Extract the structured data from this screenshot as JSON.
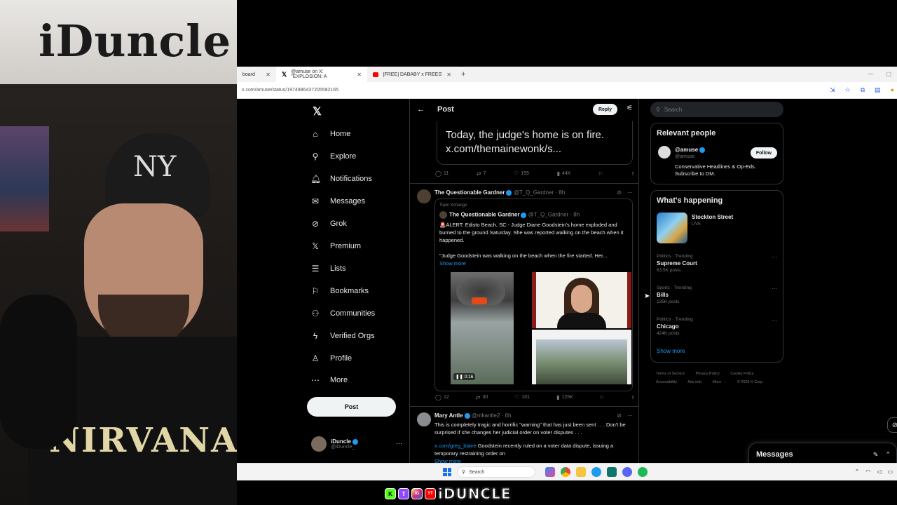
{
  "webcam": {
    "wall_logo": "iDuncle",
    "cap_logo": "NY",
    "shirt_text": "NIRVANA"
  },
  "browser": {
    "tabs": [
      {
        "label": "board",
        "active": false
      },
      {
        "label": "@amuse on X: \"EXPLOSION: A",
        "active": true
      },
      {
        "label": "[FREE] DABABY x FREESTYLE T",
        "active": false
      }
    ],
    "new_tab": "+",
    "url": "x.com/amuse/status/1974986437205582165"
  },
  "nav": {
    "items": [
      {
        "label": "Home",
        "icon": "home-icon",
        "glyph": "⌂"
      },
      {
        "label": "Explore",
        "icon": "search-icon",
        "glyph": "⚲"
      },
      {
        "label": "Notifications",
        "icon": "bell-icon",
        "glyph": "🔔︎"
      },
      {
        "label": "Messages",
        "icon": "envelope-icon",
        "glyph": "✉"
      },
      {
        "label": "Grok",
        "icon": "grok-icon",
        "glyph": "⊘"
      },
      {
        "label": "Premium",
        "icon": "x-icon",
        "glyph": "𝕏"
      },
      {
        "label": "Lists",
        "icon": "list-icon",
        "glyph": "☰"
      },
      {
        "label": "Bookmarks",
        "icon": "bookmark-icon",
        "glyph": "⚐"
      },
      {
        "label": "Communities",
        "icon": "people-icon",
        "glyph": "⚇"
      },
      {
        "label": "Verified Orgs",
        "icon": "lightning-icon",
        "glyph": "ϟ"
      },
      {
        "label": "Profile",
        "icon": "person-icon",
        "glyph": "♙"
      },
      {
        "label": "More",
        "icon": "more-icon",
        "glyph": "⋯"
      }
    ],
    "post_button": "Post",
    "profile": {
      "name": "iDuncle",
      "handle": "@iDuncle_"
    }
  },
  "main": {
    "header_title": "Post",
    "reply_button": "Reply",
    "quote_text_line1": "Today, the judge's home is on fire.",
    "quote_text_line2": "x.com/themainewonk/s...",
    "top_stats": {
      "replies": "11",
      "reposts": "7",
      "likes": "155",
      "views": "44K"
    },
    "tweet1": {
      "name": "The Questionable Gardner",
      "meta": "@T_Q_Gardner · 8h",
      "topic": "Topic Xchange",
      "inner_name": "The Questionable Gardner",
      "inner_meta": "@T_Q_Gardner · 8h",
      "inner_text": "🚨ALERT: Edisto Beach, SC - Judge Diane Goodstein's home exploded and burned to the ground Saturday. She was reported walking on the beach when it happened.",
      "inner_text2": "\"Judge Goodstein was walking on the beach when the fire started. Her...",
      "show_more": "Show more",
      "video_duration": "0:16",
      "stats": {
        "replies": "12",
        "reposts": "30",
        "likes": "101",
        "views": "125K"
      }
    },
    "tweet2": {
      "name": "Mary Antle",
      "meta": "@mkantle2 · 6h",
      "text": "This is completely tragic and horrific \"warning\" that has just been sent . . . Don't be surprised if she changes her judicial order on voter disputes . . .",
      "link": "x.com/greg_blaire",
      "text2": " Goodstein recently ruled on a voter data dispute, issuing a temporary restraining order on",
      "show_more": "Show more"
    }
  },
  "right": {
    "search_placeholder": "Search",
    "relevant_title": "Relevant people",
    "relevant_person": {
      "name": "@amuse",
      "handle": "@amuse",
      "bio": "Conservative Headlines & Op-Eds. Subscribe to DM.",
      "follow": "Follow"
    },
    "happening_title": "What's happening",
    "live_item": {
      "title": "Stockton Street",
      "status": "LIVE"
    },
    "trends": [
      {
        "category": "Politics · Trending",
        "name": "Supreme Court",
        "count": "63.5K posts"
      },
      {
        "category": "Sports · Trending",
        "name": "Bills",
        "count": "135K posts"
      },
      {
        "category": "Politics · Trending",
        "name": "Chicago",
        "count": "424K posts"
      }
    ],
    "show_more": "Show more",
    "footer": [
      "Terms of Service",
      "Privacy Policy",
      "Cookie Policy",
      "Accessibility",
      "Ads info",
      "More ···",
      "© 2025 X Corp."
    ]
  },
  "messages_drawer": {
    "title": "Messages"
  },
  "taskbar": {
    "search_placeholder": "Search"
  },
  "banner": {
    "name": "iDUNCLE",
    "icons": [
      "K",
      "T",
      "IG",
      "YT"
    ]
  },
  "colors": {
    "accent": "#1d9bf0",
    "background": "#000000",
    "text": "#e7e9ea",
    "muted": "#71767b",
    "border": "#2f3336"
  }
}
